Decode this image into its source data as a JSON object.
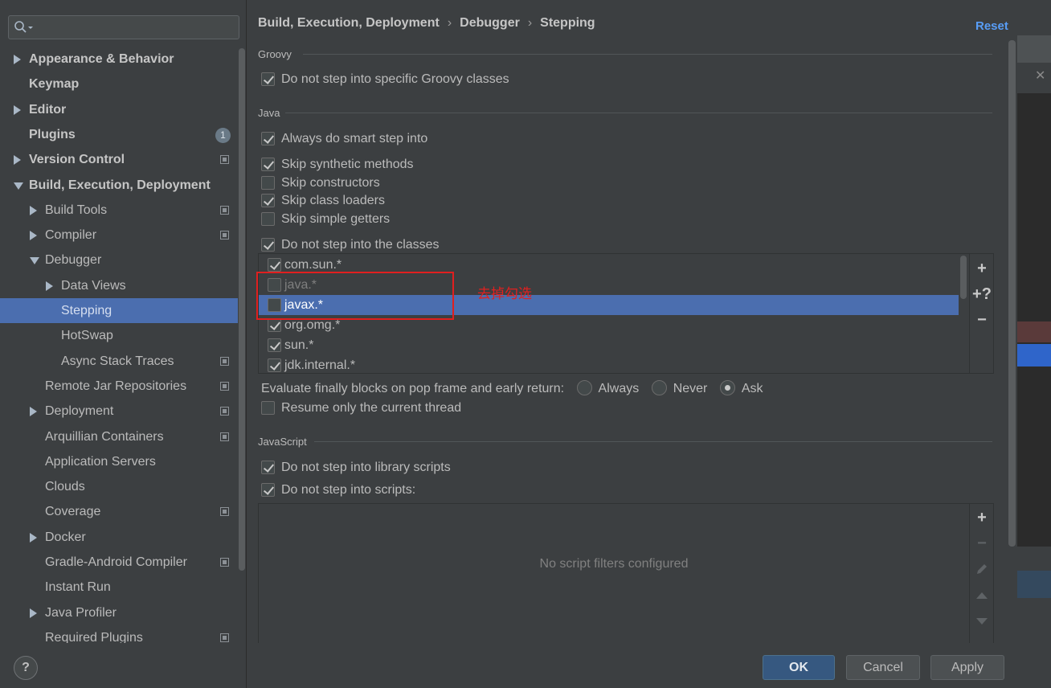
{
  "sidebar": {
    "search_placeholder": "",
    "items": [
      {
        "label": "Appearance & Behavior",
        "indent": 0,
        "arrow": "right",
        "bold": true
      },
      {
        "label": "Keymap",
        "indent": 0,
        "arrow": "",
        "bold": true
      },
      {
        "label": "Editor",
        "indent": 0,
        "arrow": "right",
        "bold": true
      },
      {
        "label": "Plugins",
        "indent": 0,
        "arrow": "",
        "bold": true,
        "badge": "1"
      },
      {
        "label": "Version Control",
        "indent": 0,
        "arrow": "right",
        "bold": true,
        "project": true
      },
      {
        "label": "Build, Execution, Deployment",
        "indent": 0,
        "arrow": "down",
        "bold": true
      },
      {
        "label": "Build Tools",
        "indent": 1,
        "arrow": "right",
        "project": true
      },
      {
        "label": "Compiler",
        "indent": 1,
        "arrow": "right",
        "project": true
      },
      {
        "label": "Debugger",
        "indent": 1,
        "arrow": "down"
      },
      {
        "label": "Data Views",
        "indent": 2,
        "arrow": "right"
      },
      {
        "label": "Stepping",
        "indent": 2,
        "arrow": "",
        "selected": true
      },
      {
        "label": "HotSwap",
        "indent": 2,
        "arrow": ""
      },
      {
        "label": "Async Stack Traces",
        "indent": 2,
        "arrow": "",
        "project": true
      },
      {
        "label": "Remote Jar Repositories",
        "indent": 1,
        "arrow": "",
        "project": true
      },
      {
        "label": "Deployment",
        "indent": 1,
        "arrow": "right",
        "project": true
      },
      {
        "label": "Arquillian Containers",
        "indent": 1,
        "arrow": "",
        "project": true
      },
      {
        "label": "Application Servers",
        "indent": 1,
        "arrow": ""
      },
      {
        "label": "Clouds",
        "indent": 1,
        "arrow": ""
      },
      {
        "label": "Coverage",
        "indent": 1,
        "arrow": "",
        "project": true
      },
      {
        "label": "Docker",
        "indent": 1,
        "arrow": "right"
      },
      {
        "label": "Gradle-Android Compiler",
        "indent": 1,
        "arrow": "",
        "project": true
      },
      {
        "label": "Instant Run",
        "indent": 1,
        "arrow": ""
      },
      {
        "label": "Java Profiler",
        "indent": 1,
        "arrow": "right"
      },
      {
        "label": "Required Plugins",
        "indent": 1,
        "arrow": "",
        "project": true
      }
    ],
    "help_label": "?"
  },
  "breadcrumb": [
    "Build, Execution, Deployment",
    "Debugger",
    "Stepping"
  ],
  "breadcrumb_sep": "›",
  "reset_label": "Reset",
  "groovy": {
    "title": "Groovy",
    "options": [
      {
        "label": "Do not step into specific Groovy classes",
        "checked": true
      }
    ]
  },
  "java": {
    "title": "Java",
    "options": [
      {
        "label": "Always do smart step into",
        "checked": true
      },
      {
        "label": "Skip synthetic methods",
        "checked": true
      },
      {
        "label": "Skip constructors",
        "checked": false
      },
      {
        "label": "Skip class loaders",
        "checked": true
      },
      {
        "label": "Skip simple getters",
        "checked": false
      },
      {
        "label": "Do not step into the classes",
        "checked": true
      }
    ],
    "classes": [
      {
        "name": "com.sun.*",
        "checked": true
      },
      {
        "name": "java.*",
        "checked": false,
        "dim": true
      },
      {
        "name": "javax.*",
        "checked": false,
        "selected": true
      },
      {
        "name": "org.omg.*",
        "checked": true
      },
      {
        "name": "sun.*",
        "checked": true
      },
      {
        "name": "jdk.internal.*",
        "checked": true
      }
    ],
    "class_tools": {
      "add_class_icon": "+",
      "add_pattern_icon": "+?",
      "remove_icon": "−"
    },
    "finally_label": "Evaluate finally blocks on pop frame and early return:",
    "finally_options": [
      {
        "label": "Always",
        "selected": false
      },
      {
        "label": "Never",
        "selected": false
      },
      {
        "label": "Ask",
        "selected": true
      }
    ],
    "resume_label": "Resume only the current thread",
    "resume_checked": false
  },
  "annotation": {
    "text": "去掉勾选",
    "color": "#e01f1f"
  },
  "javascript": {
    "title": "JavaScript",
    "options": [
      {
        "label": "Do not step into library scripts",
        "checked": true
      },
      {
        "label": "Do not step into scripts:",
        "checked": true
      }
    ],
    "empty_text": "No script filters configured",
    "tools": [
      "plus-icon",
      "minus-icon",
      "edit-icon",
      "up-icon",
      "down-icon"
    ]
  },
  "buttons": {
    "ok": "OK",
    "cancel": "Cancel",
    "apply": "Apply"
  },
  "colors": {
    "selection": "#4b6eaf",
    "accent_link": "#589df6",
    "primary_button": "#365880"
  }
}
